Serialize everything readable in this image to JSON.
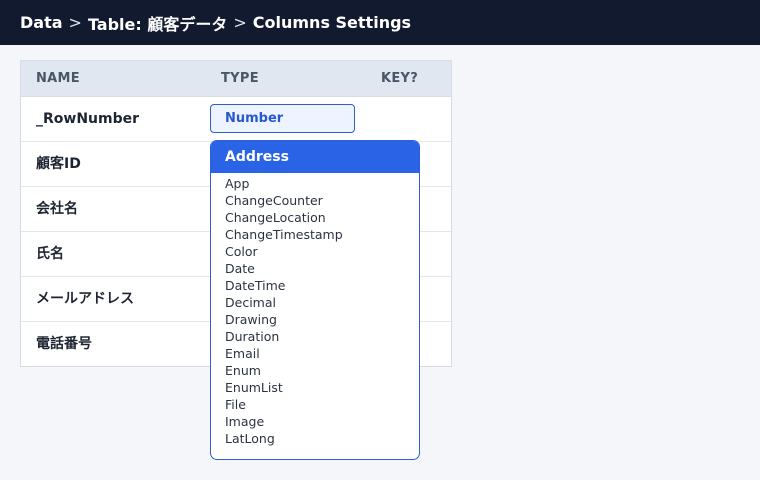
{
  "breadcrumb": {
    "items": [
      "Data",
      "Table: 顧客データ",
      "Columns Settings"
    ],
    "separator": ">"
  },
  "table": {
    "headers": {
      "name": "NAME",
      "type": "TYPE",
      "key": "KEY?"
    },
    "rows": [
      {
        "name": "_RowNumber",
        "type": "Number"
      },
      {
        "name": "顧客ID"
      },
      {
        "name": "会社名"
      },
      {
        "name": "氏名"
      },
      {
        "name": "メールアドレス"
      },
      {
        "name": "電話番号"
      }
    ]
  },
  "type_dropdown": {
    "selected": "Address",
    "options": [
      "App",
      "ChangeCounter",
      "ChangeLocation",
      "ChangeTimestamp",
      "Color",
      "Date",
      "DateTime",
      "Decimal",
      "Drawing",
      "Duration",
      "Email",
      "Enum",
      "EnumList",
      "File",
      "Image",
      "LatLong"
    ]
  },
  "colors": {
    "topbar": "#111a2e",
    "accent": "#2a63e6",
    "header_row": "#e1e7f0",
    "chip_bg": "#eef4ff"
  }
}
